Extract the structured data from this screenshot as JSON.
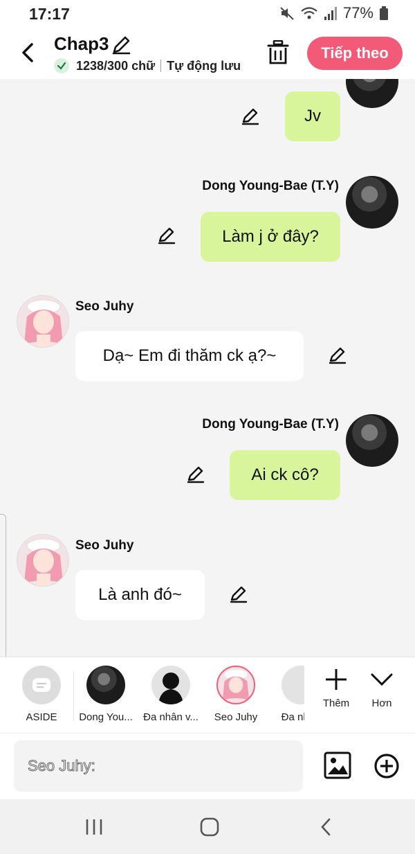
{
  "status": {
    "time": "17:17",
    "battery": "77%"
  },
  "header": {
    "title": "Chap3",
    "word_count": "1238/300 chữ",
    "autosave": "Tự động lưu",
    "next_label": "Tiếp theo"
  },
  "messages": [
    {
      "sender": "",
      "text": "Jv",
      "side": "right"
    },
    {
      "sender": "Dong Young-Bae (T.Y)",
      "text": "Làm j ở đây?",
      "side": "right"
    },
    {
      "sender": "Seo Juhy",
      "text": "Dạ~ Em đi thăm ck ạ?~",
      "side": "left"
    },
    {
      "sender": "Dong Young-Bae (T.Y)",
      "text": "Ai ck cô?",
      "side": "right"
    },
    {
      "sender": "Seo Juhy",
      "text": "Là anh đó~",
      "side": "left"
    }
  ],
  "characters": [
    {
      "label": "ASIDE",
      "icon": "aside-chat-icon"
    },
    {
      "label": "Dong You...",
      "icon": "avatar-dong"
    },
    {
      "label": "Đa nhân v...",
      "icon": "avatar-silhouette"
    },
    {
      "label": "Seo Juhy",
      "icon": "avatar-seo-juhy",
      "selected": true
    },
    {
      "label": "Đa nhân",
      "icon": "avatar-partial"
    }
  ],
  "more_actions": {
    "add_label": "Thêm",
    "more_label": "Hơn"
  },
  "input": {
    "placeholder": "Seo Juhy:"
  },
  "colors": {
    "accent": "#f35a78",
    "bubble_right": "#d8f59b",
    "bubble_left": "#ffffff",
    "background": "#f4f4f4"
  }
}
